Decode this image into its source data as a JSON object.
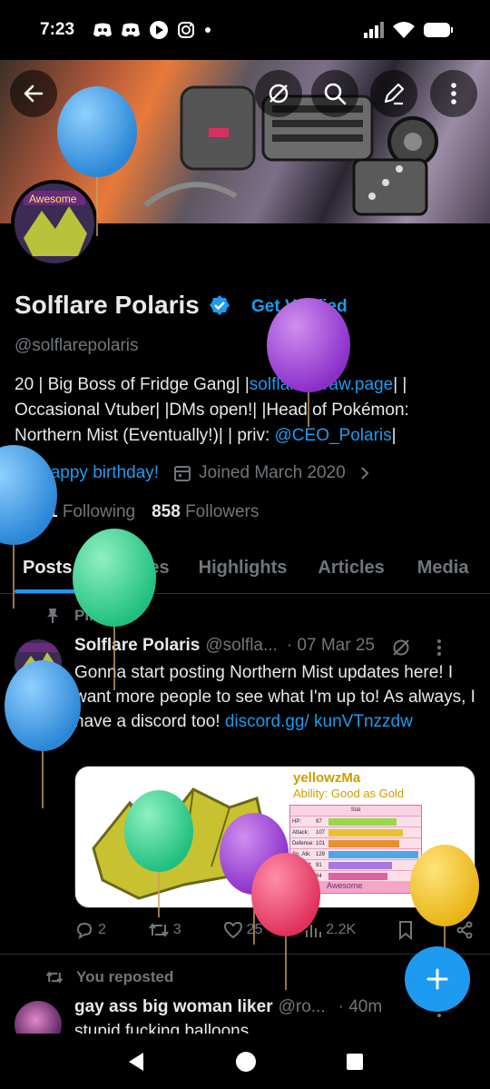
{
  "status_bar": {
    "time": "7:23"
  },
  "profile": {
    "name": "Solflare Polaris",
    "get_verified": "Get Verified",
    "handle": "@solflarepolaris",
    "bio_1": "20 | Big Boss of Fridge Gang| |",
    "bio_link": "solflare.straw.page",
    "bio_2": "| | Occasional Vtuber| |DMs open!| |Head of Pokémon: Northern Mist (Eventually!)| | priv: ",
    "bio_mention": "@CEO_Polaris",
    "bio_3": "|",
    "birthday": "Happy birthday!",
    "joined": "Joined March 2020",
    "following_count": "2,691",
    "following_label": "Following",
    "followers_count": "858",
    "followers_label": "Followers",
    "avatar_text": "Awesome"
  },
  "tabs": [
    "Posts",
    "Replies",
    "Highlights",
    "Articles",
    "Media"
  ],
  "pinned_label": "Pinned",
  "post": {
    "author": "Solflare Polaris",
    "handle": "@solfla...",
    "date": "· 07 Mar 25",
    "text": "Gonna start posting Northern Mist updates here! I want more people to see what I'm up to! As always, I have a discord too! ",
    "link": "discord.gg/ kunVTnzzdw",
    "media": {
      "title": "yellowzMa",
      "ability": "Ability: Good as Gold",
      "stat_header": "Stat",
      "stats": [
        {
          "name": "HP:",
          "value": "97"
        },
        {
          "name": "Attack:",
          "value": "107"
        },
        {
          "name": "Defense:",
          "value": "101"
        },
        {
          "name": "Sp. Atk:",
          "value": "129"
        },
        {
          "name": "Sp. Def:",
          "value": "91"
        },
        {
          "name": "Speed:",
          "value": "84"
        }
      ],
      "footer": "Awesome"
    },
    "replies": "2",
    "reposts": "3",
    "likes": "25",
    "views": "2.2K"
  },
  "reposted_label": "You reposted",
  "post2": {
    "author": "gay ass big woman liker",
    "handle": "@ro...",
    "date": "· 40m",
    "text": "stupid fucking balloons"
  },
  "colors": {
    "accent": "#1d9bf0",
    "background": "#000000",
    "secondary_text": "#71767b"
  }
}
